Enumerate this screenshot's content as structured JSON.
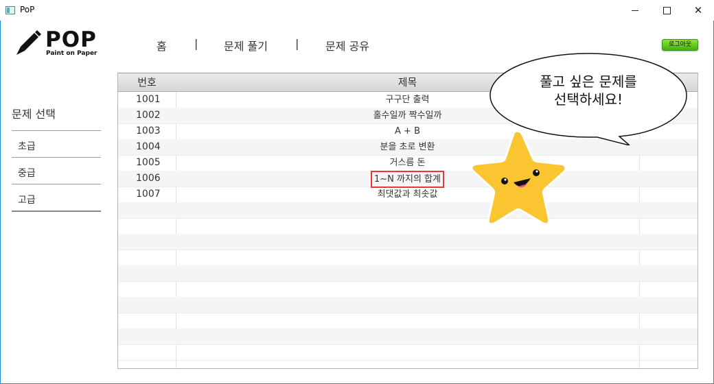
{
  "window": {
    "title": "PoP"
  },
  "logo": {
    "text": "POP",
    "subtitle": "Paint on Paper"
  },
  "nav": {
    "home": "홈",
    "separator": "|",
    "solve": "문제 풀기",
    "share": "문제 공유"
  },
  "logout": {
    "label": "로그아웃"
  },
  "sidebar": {
    "title": "문제 선택",
    "items": [
      {
        "label": "초급"
      },
      {
        "label": "중급"
      },
      {
        "label": "고급"
      }
    ]
  },
  "table": {
    "headers": {
      "number": "번호",
      "title": "제목"
    },
    "rows": [
      {
        "number": "1001",
        "title": "구구단 출력"
      },
      {
        "number": "1002",
        "title": "홀수일까 짝수일까"
      },
      {
        "number": "1003",
        "title": "A + B"
      },
      {
        "number": "1004",
        "title": "분을 초로 변환"
      },
      {
        "number": "1005",
        "title": "거스름 돈"
      },
      {
        "number": "1006",
        "title": "1~N 까지의 합계"
      },
      {
        "number": "1007",
        "title": "최댓값과 최솟값"
      }
    ],
    "highlighted_row": "1006"
  },
  "bubble": {
    "line1": "풀고 싶은 문제를",
    "line2": "선택하세요!"
  },
  "colors": {
    "logout_green": "#5fcd1c",
    "highlight_red": "#e53935",
    "star_yellow": "#fbc02d"
  },
  "icons": {
    "logo": "pencil-icon",
    "mascot": "star-mascot-icon"
  }
}
